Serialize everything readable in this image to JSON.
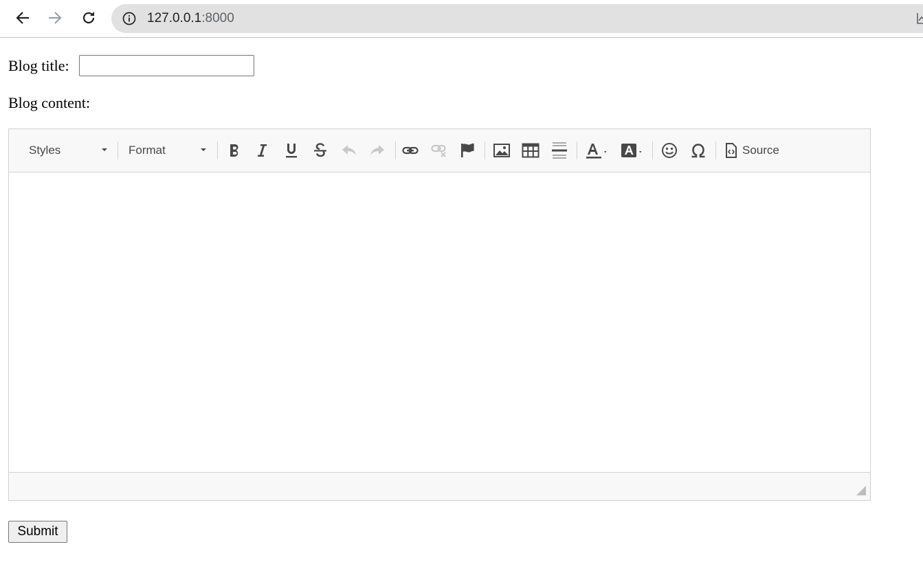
{
  "browser": {
    "url_host": "127.0.0.1",
    "url_port": ":8000"
  },
  "form": {
    "title_label": "Blog title:",
    "title_value": "",
    "content_label": "Blog content:",
    "submit_label": "Submit"
  },
  "editor": {
    "styles_label": "Styles",
    "format_label": "Format",
    "source_label": "Source",
    "toolbar_icons": [
      "bold-icon",
      "italic-icon",
      "underline-icon",
      "strikethrough-icon",
      "undo-icon",
      "redo-icon",
      "link-icon",
      "unlink-icon",
      "anchor-icon",
      "image-icon",
      "table-icon",
      "horizontal-line-icon",
      "text-color-icon",
      "background-color-icon",
      "smiley-icon",
      "special-char-icon",
      "source-icon"
    ],
    "icon_color": "#484848",
    "disabled_color": "#c8c8c8"
  }
}
